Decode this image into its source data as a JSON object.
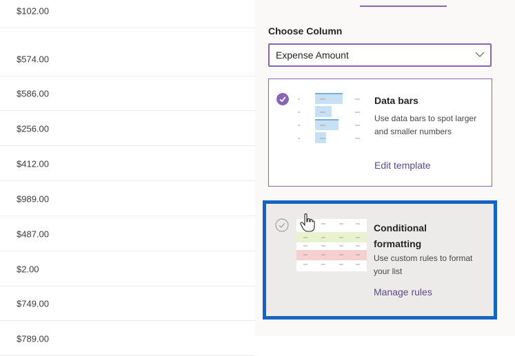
{
  "list": {
    "amounts": [
      "$102.00",
      "$574.00",
      "$586.00",
      "$256.00",
      "$412.00",
      "$989.00",
      "$487.00",
      "$2.00",
      "$749.00",
      "$789.00"
    ]
  },
  "panel": {
    "choose_column_label": "Choose Column",
    "column_select_value": "Expense Amount",
    "templates": [
      {
        "title": "Data bars",
        "description": "Use data bars to spot larger and smaller numbers",
        "link": "Edit template",
        "selected": true
      },
      {
        "title": "Conditional formatting",
        "description": "Use custom rules to format your list",
        "link": "Manage rules",
        "selected": false
      }
    ]
  },
  "colors": {
    "accent": "#8764b8",
    "highlight_border": "#1565c0",
    "bar_blue": "#c7e0f4",
    "row_green": "#e9f2cf",
    "row_red": "#f6d0d0"
  },
  "icons": [
    "chevron-down-icon",
    "checkmark-circle-icon",
    "hand-pointer-cursor-icon"
  ]
}
